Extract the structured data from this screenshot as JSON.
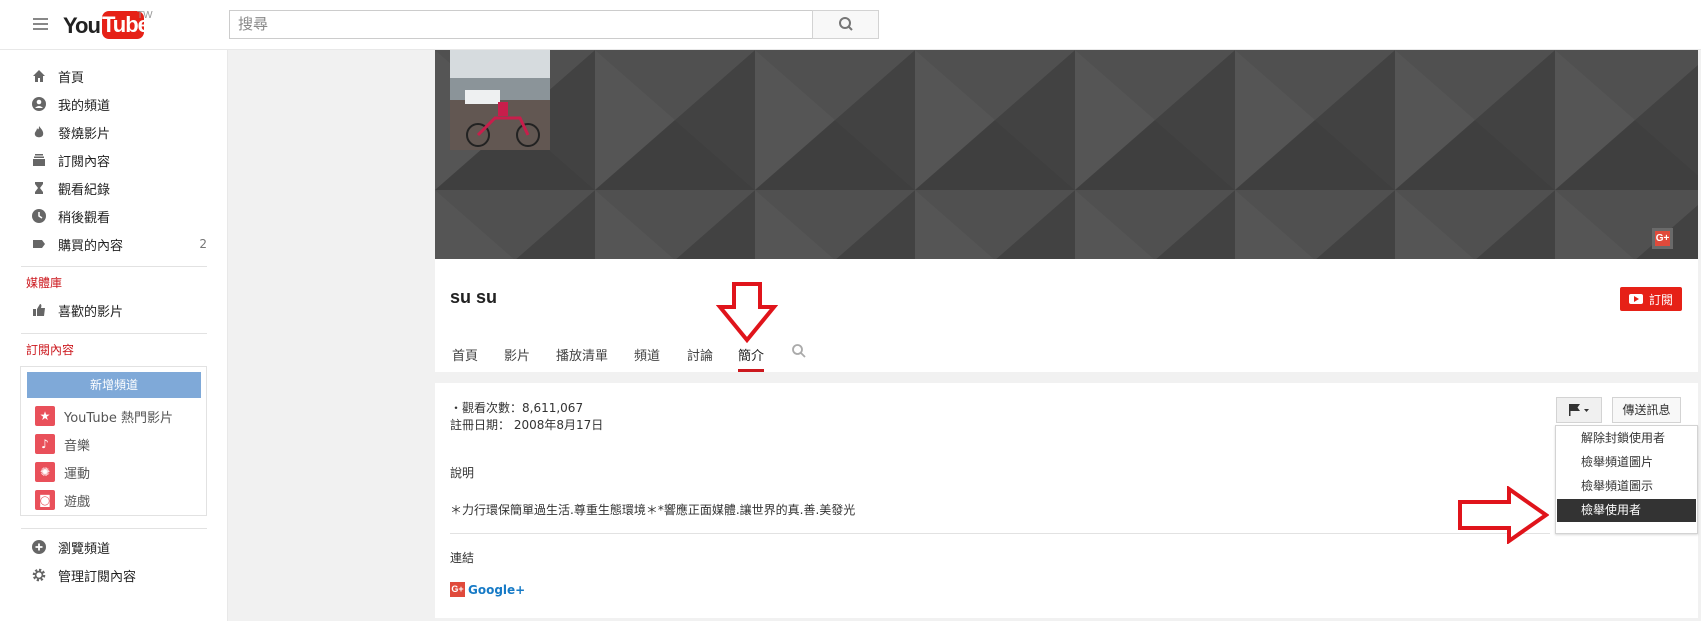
{
  "header": {
    "logo_you": "You",
    "logo_tube": "Tube",
    "region": "TW",
    "search_placeholder": "搜尋"
  },
  "sidebar": {
    "items": [
      {
        "label": "首頁",
        "icon": "home-icon"
      },
      {
        "label": "我的頻道",
        "icon": "account-icon"
      },
      {
        "label": "發燒影片",
        "icon": "flame-icon"
      },
      {
        "label": "訂閱內容",
        "icon": "subscriptions-icon"
      },
      {
        "label": "觀看紀錄",
        "icon": "hourglass-icon"
      },
      {
        "label": "稍後觀看",
        "icon": "clock-icon"
      },
      {
        "label": "購買的內容",
        "icon": "tag-icon",
        "count": "2"
      }
    ],
    "library_title": "媒體庫",
    "library_items": [
      {
        "label": "喜歡的影片",
        "icon": "thumbs-up-icon"
      }
    ],
    "subscriptions_title": "訂閱內容",
    "add_channel": "新增頻道",
    "subscriptions": [
      {
        "label": "YouTube 熱門影片",
        "icon": "star-icon"
      },
      {
        "label": "音樂",
        "icon": "music-note-icon"
      },
      {
        "label": "運動",
        "icon": "ball-icon"
      },
      {
        "label": "遊戲",
        "icon": "gamepad-icon"
      }
    ],
    "bottom_items": [
      {
        "label": "瀏覽頻道",
        "icon": "plus-circle-icon"
      },
      {
        "label": "管理訂閱內容",
        "icon": "gear-icon"
      }
    ]
  },
  "channel": {
    "name": "su su",
    "subscribe_label": "訂閱",
    "banner_badge": "G+",
    "tabs": [
      "首頁",
      "影片",
      "播放清單",
      "頻道",
      "討論",
      "簡介"
    ],
    "active_tab": "簡介"
  },
  "about": {
    "views": "・觀看次數：8,611,067",
    "joined": "註冊日期： 2008年8月17日",
    "description_title": "說明",
    "description": "＊力行環保簡單過生活.尊重生態環境＊*響應正面媒體.讓世界的真.善.美發光",
    "links_title": "連結",
    "gplus_label": "Google+",
    "gplus_badge": "G+",
    "send_message": "傳送訊息"
  },
  "flag_menu": {
    "items": [
      "解除封鎖使用者",
      "檢舉頻道圖片",
      "檢舉頻道圖示",
      "檢舉使用者"
    ],
    "highlighted": "檢舉使用者"
  },
  "colors": {
    "brand_red": "#e62117",
    "annotation_red": "#e0141b",
    "section_red": "#cc181e",
    "add_channel_blue": "#7fa9d8",
    "banner_gray": "#4a4a4a",
    "link_blue": "#167ac6"
  }
}
